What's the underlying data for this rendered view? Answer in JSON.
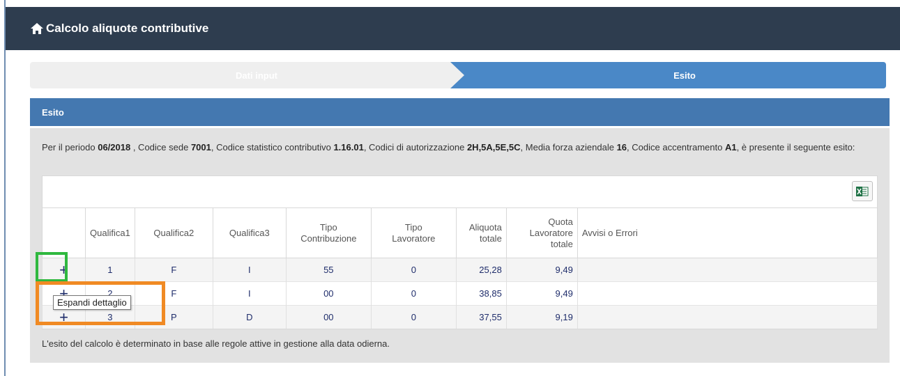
{
  "header": {
    "title": "Calcolo aliquote contributive",
    "icon": "home-icon"
  },
  "wizard": {
    "step1": "Dati input",
    "step2": "Esito",
    "active_color": "#4a88c7"
  },
  "panel": {
    "title": "Esito",
    "intro": {
      "t1": "Per il periodo ",
      "period": "06/2018",
      "t2": " , Codice sede ",
      "sede": "7001",
      "t3": ", Codice statistico contributivo ",
      "stat": "1.16.01",
      "t4": ", Codici di autorizzazione ",
      "auth": "2H,5A,5E,5C",
      "t5": ", Media forza aziendale ",
      "forza": "16",
      "t6": ", Codice accentramento ",
      "acc": "A1",
      "t7": ", è presente il seguente esito:"
    },
    "export_icon": "excel-icon",
    "footnote": "L'esito del calcolo è determinato in base alle regole attive in gestione alla data odierna."
  },
  "table": {
    "headers": {
      "qualifica1": "Qualifica1",
      "qualifica2": "Qualifica2",
      "qualifica3": "Qualifica3",
      "tipo_contribuzione_1": "Tipo",
      "tipo_contribuzione_2": "Contribuzione",
      "tipo_lavoratore_1": "Tipo",
      "tipo_lavoratore_2": "Lavoratore",
      "aliquota_1": "Aliquota",
      "aliquota_2": "totale",
      "quota_1": "Quota",
      "quota_2": "Lavoratore",
      "quota_3": "totale",
      "avvisi": "Avvisi o Errori"
    },
    "rows": [
      {
        "expand": "+",
        "q1": "1",
        "q2": "F",
        "q3": "I",
        "tipo_contr": "55",
        "tipo_lav": "0",
        "aliquota": "25,28",
        "quota": "9,49",
        "avvisi": ""
      },
      {
        "expand": "+",
        "q1": "2",
        "q2": "F",
        "q3": "I",
        "tipo_contr": "00",
        "tipo_lav": "0",
        "aliquota": "38,85",
        "quota": "9,49",
        "avvisi": ""
      },
      {
        "expand": "+",
        "q1": "3",
        "q2": "P",
        "q3": "D",
        "tipo_contr": "00",
        "tipo_lav": "0",
        "aliquota": "37,55",
        "quota": "9,19",
        "avvisi": ""
      }
    ]
  },
  "tooltip": "Espandi dettaglio",
  "highlights": {
    "green": "#2fb83f",
    "orange": "#f08a24"
  }
}
